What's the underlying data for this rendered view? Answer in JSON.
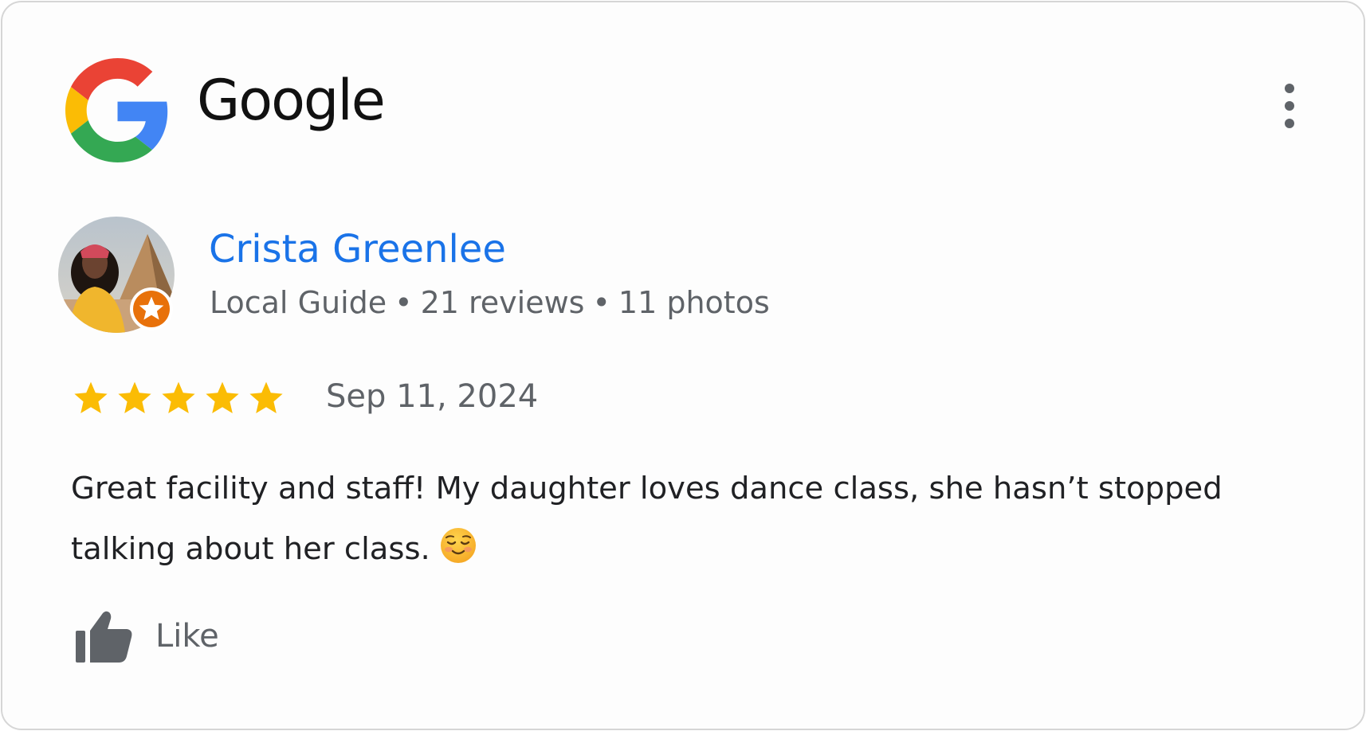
{
  "header": {
    "brand": "Google",
    "logo_icon": "google-g-icon",
    "more_icon": "more-vertical-icon"
  },
  "reviewer": {
    "name": "Crista Greenlee",
    "badge": "Local Guide",
    "separator": "•",
    "reviews": "21 reviews",
    "photos": "11 photos",
    "badge_icon": "local-guide-star-icon"
  },
  "review": {
    "rating": 5,
    "max_rating": 5,
    "date": "Sep 11, 2024",
    "text": "Great facility and staff! My daughter loves dance class, she hasn’t stopped talking about her class.",
    "emoji_icon": "smiling-face-emoji-icon"
  },
  "actions": {
    "like_label": "Like",
    "like_icon": "thumbs-up-icon"
  },
  "colors": {
    "name_link": "#1a73e8",
    "secondary_text": "#5f6368",
    "star": "#fbbc04",
    "badge_orange": "#e8710a",
    "google_red": "#ea4335",
    "google_yellow": "#fbbc05",
    "google_green": "#34a853",
    "google_blue": "#4285f4"
  }
}
